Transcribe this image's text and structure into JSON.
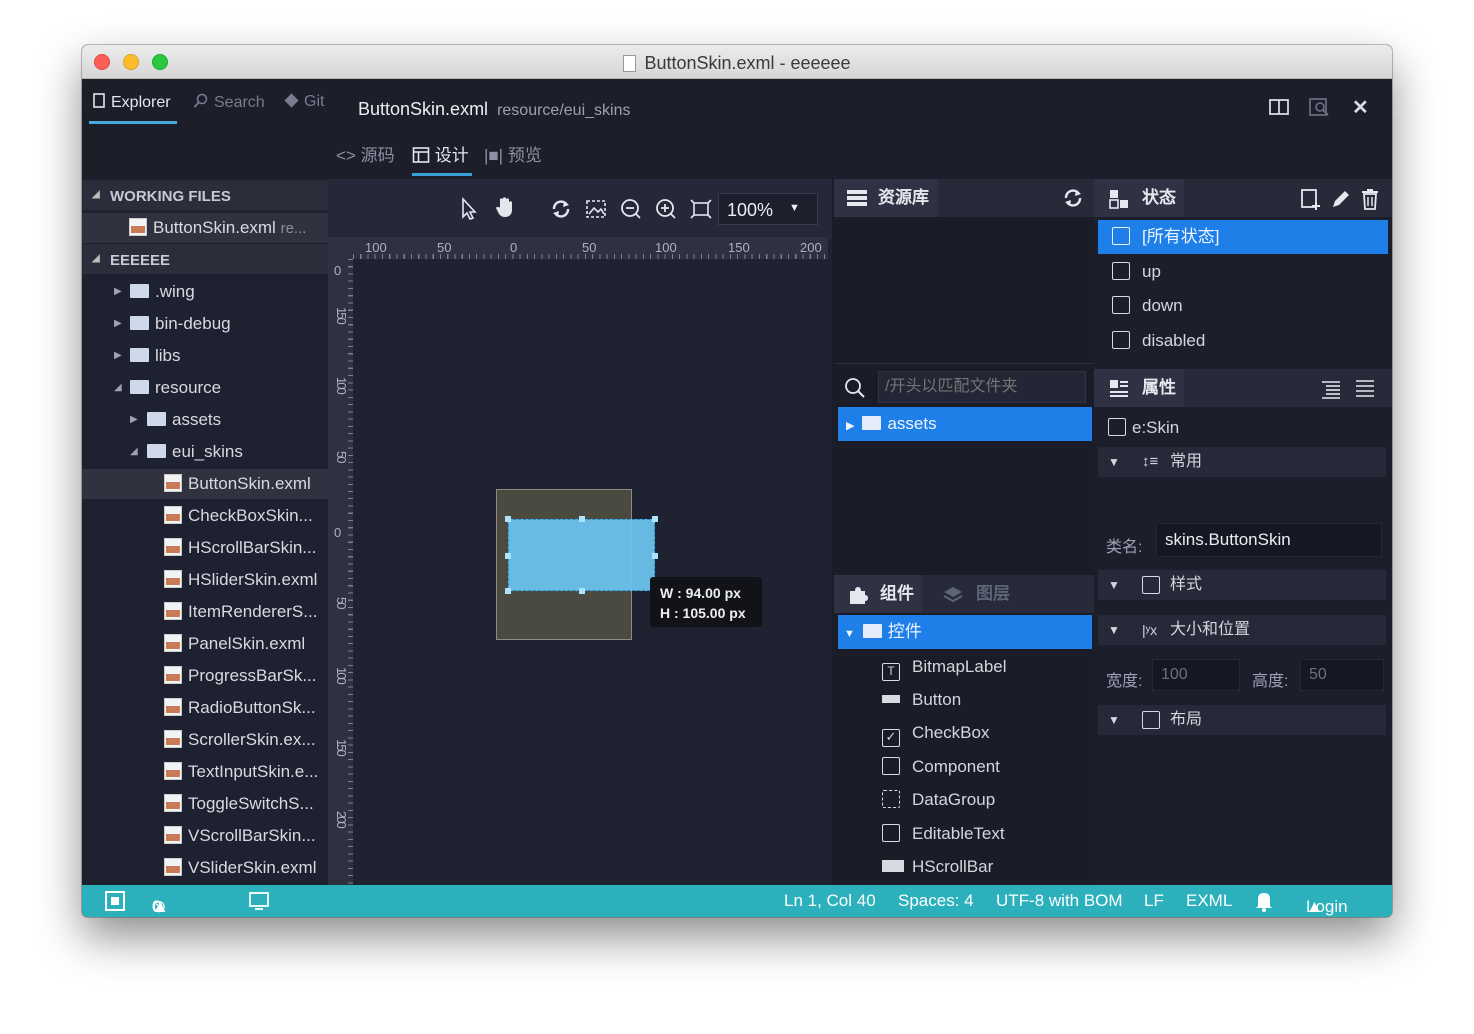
{
  "window": {
    "title": "ButtonSkin.exml - eeeeee"
  },
  "sidebar": {
    "tabs": [
      {
        "label": "Explorer"
      },
      {
        "label": "Search"
      },
      {
        "label": "Git"
      }
    ],
    "working_files": {
      "label": "WORKING FILES",
      "items": [
        {
          "name": "ButtonSkin.exml",
          "hint": "re..."
        }
      ]
    },
    "project": {
      "label": "EEEEEE"
    },
    "tree": [
      {
        "name": ".wing"
      },
      {
        "name": "bin-debug"
      },
      {
        "name": "libs"
      },
      {
        "name": "resource"
      },
      {
        "name": "assets"
      },
      {
        "name": "eui_skins"
      },
      {
        "name": "ButtonSkin.exml"
      },
      {
        "name": "CheckBoxSkin..."
      },
      {
        "name": "HScrollBarSkin..."
      },
      {
        "name": "HSliderSkin.exml"
      },
      {
        "name": "ItemRendererS..."
      },
      {
        "name": "PanelSkin.exml"
      },
      {
        "name": "ProgressBarSk..."
      },
      {
        "name": "RadioButtonSk..."
      },
      {
        "name": "ScrollerSkin.ex..."
      },
      {
        "name": "TextInputSkin.e..."
      },
      {
        "name": "ToggleSwitchS..."
      },
      {
        "name": "VScrollBarSkin..."
      },
      {
        "name": "VSliderSkin.exml"
      }
    ]
  },
  "editor": {
    "file": "ButtonSkin.exml",
    "path": "resource/eui_skins",
    "modes": [
      {
        "label": "源码"
      },
      {
        "label": "设计"
      },
      {
        "label": "预览"
      }
    ],
    "zoom": "100%",
    "ruler_h": [
      "100",
      "50",
      "0",
      "50",
      "100",
      "150",
      "200"
    ],
    "ruler_v": [
      "0",
      "150",
      "100",
      "50",
      "0",
      "50",
      "100",
      "150",
      "200"
    ],
    "selection": {
      "w": "W : 94.00 px",
      "h": "H : 105.00 px"
    }
  },
  "resources": {
    "title": "资源库",
    "search_placeholder": "/开头以匹配文件夹",
    "items": [
      {
        "name": "assets"
      }
    ]
  },
  "components": {
    "tabs": [
      {
        "label": "组件"
      },
      {
        "label": "图层"
      }
    ],
    "group": "控件",
    "items": [
      {
        "name": "BitmapLabel"
      },
      {
        "name": "Button"
      },
      {
        "name": "CheckBox"
      },
      {
        "name": "Component"
      },
      {
        "name": "DataGroup"
      },
      {
        "name": "EditableText"
      },
      {
        "name": "HScrollBar"
      }
    ]
  },
  "states": {
    "title": "状态",
    "items": [
      {
        "name": "[所有状态]"
      },
      {
        "name": "up"
      },
      {
        "name": "down"
      },
      {
        "name": "disabled"
      }
    ]
  },
  "properties": {
    "title": "属性",
    "target": "e:Skin",
    "groups": {
      "common": "常用",
      "style": "样式",
      "size": "大小和位置",
      "layout": "布局"
    },
    "class_label": "类名:",
    "class_value": "skins.ButtonSkin",
    "width_label": "宽度:",
    "width_value": "100",
    "height_label": "高度:",
    "height_value": "50"
  },
  "statusbar": {
    "errors": "0",
    "warnings": "0",
    "position": "Ln 1, Col 40",
    "spaces": "Spaces: 4",
    "encoding": "UTF-8 with BOM",
    "eol": "LF",
    "language": "EXML",
    "login": "Login"
  },
  "colors": {
    "accent": "#1e7fe9",
    "status": "#2bb0bc",
    "selection": "#6ac3ec"
  }
}
